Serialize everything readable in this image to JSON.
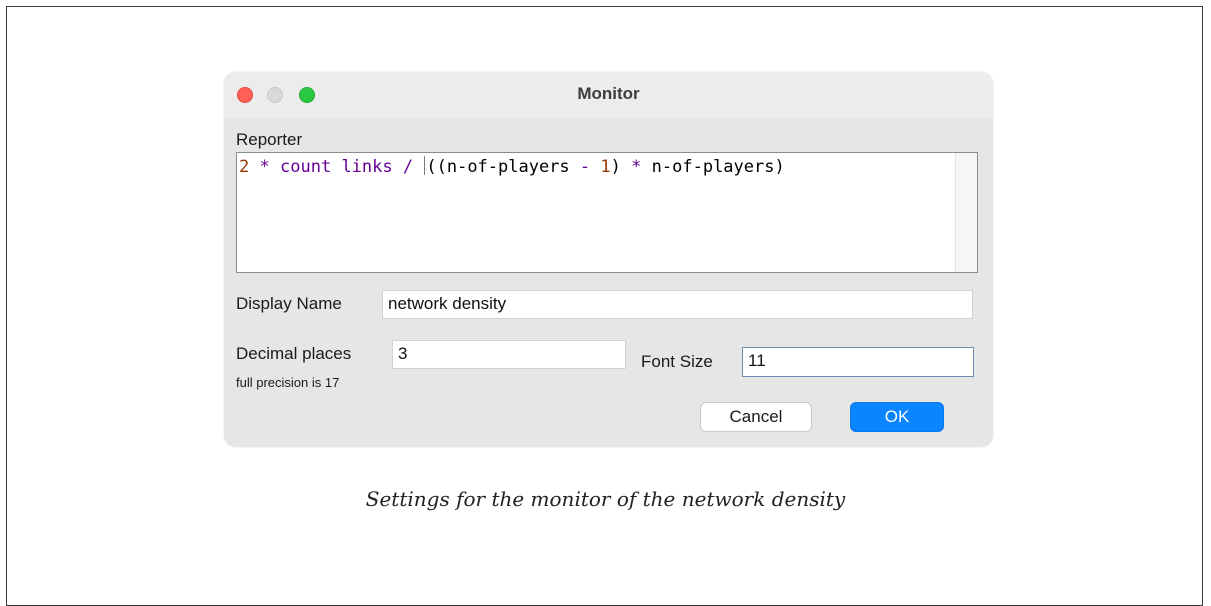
{
  "dialog": {
    "title": "Monitor",
    "reporter_label": "Reporter",
    "reporter_tokens": [
      {
        "text": "2",
        "kind": "num"
      },
      {
        "text": " ",
        "kind": "plain"
      },
      {
        "text": "*",
        "kind": "prim"
      },
      {
        "text": " ",
        "kind": "plain"
      },
      {
        "text": "count",
        "kind": "prim"
      },
      {
        "text": " ",
        "kind": "plain"
      },
      {
        "text": "links",
        "kind": "prim"
      },
      {
        "text": " ",
        "kind": "plain"
      },
      {
        "text": "/",
        "kind": "prim"
      },
      {
        "text": " ",
        "kind": "plain"
      },
      {
        "text": "((n-of-players",
        "kind": "plain"
      },
      {
        "text": " ",
        "kind": "plain"
      },
      {
        "text": "-",
        "kind": "prim"
      },
      {
        "text": " ",
        "kind": "plain"
      },
      {
        "text": "1",
        "kind": "num"
      },
      {
        "text": ")",
        "kind": "plain"
      },
      {
        "text": " ",
        "kind": "plain"
      },
      {
        "text": "*",
        "kind": "prim"
      },
      {
        "text": " n-of-players)",
        "kind": "plain"
      }
    ],
    "display_name_label": "Display Name",
    "display_name_value": "network density",
    "decimal_places_label": "Decimal places",
    "decimal_places_value": "3",
    "precision_hint": "full precision is 17",
    "font_size_label": "Font Size",
    "font_size_value": "11",
    "cancel_label": "Cancel",
    "ok_label": "OK"
  },
  "caption": "Settings for the monitor of the network density",
  "colors": {
    "number": "#963700",
    "primitive": "#660096",
    "ok_button": "#0a84ff"
  }
}
